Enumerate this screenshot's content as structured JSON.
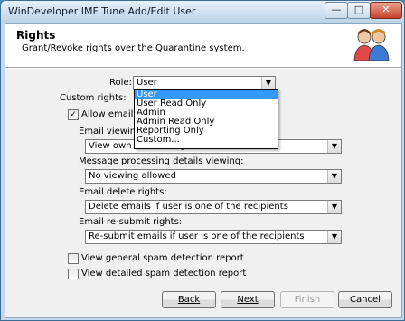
{
  "window": {
    "title": "WinDeveloper IMF Tune Add/Edit User",
    "controls": [
      "minimize",
      "maximize",
      "close"
    ]
  },
  "header": {
    "title": "Rights",
    "subtitle": "Grant/Revoke rights over the Quarantine system.",
    "icon": "users-icon"
  },
  "role": {
    "label": "Role:",
    "value": "User",
    "options": [
      "User",
      "User Read Only",
      "Admin",
      "Admin Read Only",
      "Reporting Only",
      "Custom..."
    ],
    "selected_index": 0
  },
  "custom_rights": {
    "label": "Custom rights:",
    "allow_email": {
      "label": "Allow email ac",
      "checked": true
    },
    "email_viewing": {
      "label": "Email viewing:",
      "value": "View own emails only"
    },
    "msg_processing": {
      "label": "Message processing details viewing:",
      "value": "No viewing allowed"
    },
    "email_delete": {
      "label": "Email delete rights:",
      "value": "Delete emails if user is one of the recipients"
    },
    "email_resubmit": {
      "label": "Email re-submit rights:",
      "value": "Re-submit emails if user is one of the recipients"
    },
    "general_spam": {
      "label": "View general spam detection report",
      "checked": false
    },
    "detailed_spam": {
      "label": "View detailed spam detection report",
      "checked": false
    }
  },
  "buttons": {
    "back": "Back",
    "next": "Next",
    "finish": "Finish",
    "cancel": "Cancel"
  }
}
